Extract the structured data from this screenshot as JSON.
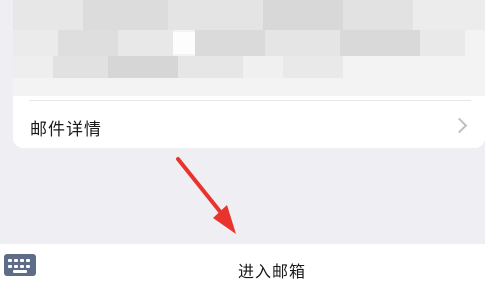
{
  "card": {
    "detail_label": "邮件详情"
  },
  "bottom_bar": {
    "enter_mailbox_label": "进入邮箱"
  },
  "icons": {
    "chevron": "chevron-right-icon",
    "keyboard": "keyboard-icon",
    "annotation_arrow": "arrow-icon"
  },
  "colors": {
    "page_background": "#eeeef3",
    "card_background": "#ffffff",
    "annotation_arrow": "#e8342c",
    "keyboard_icon": "#5e6c88"
  }
}
